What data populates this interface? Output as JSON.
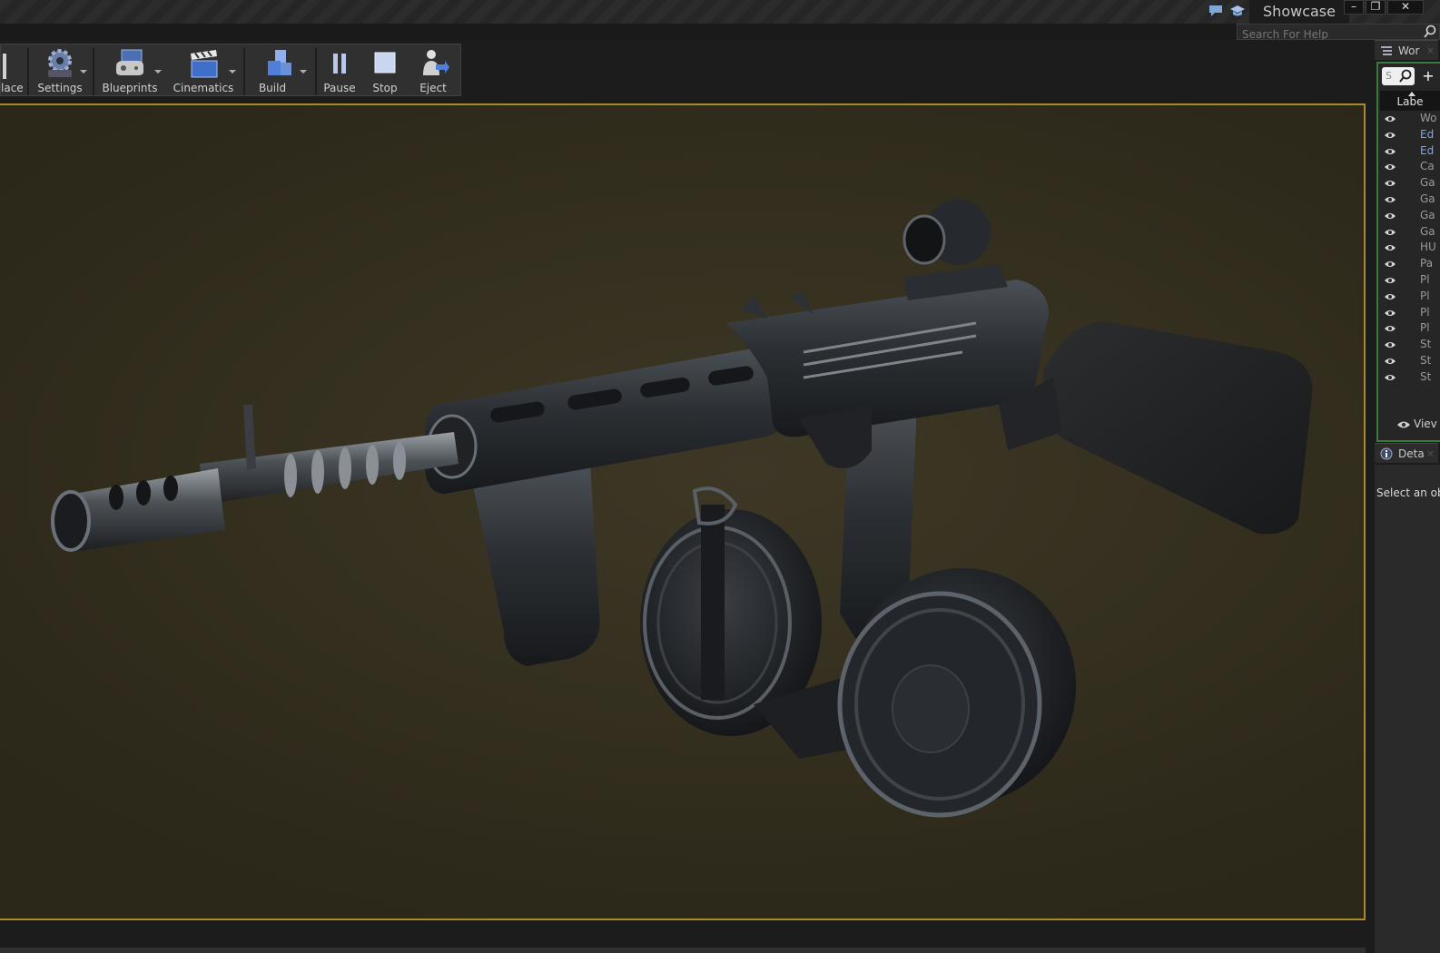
{
  "title_bar": {
    "project_name": "Showcase",
    "minimize": "–",
    "restore": "❐",
    "close": "✕"
  },
  "help_search": {
    "placeholder": "Search For Help"
  },
  "toolbar": {
    "buttons": [
      {
        "label": "lace"
      },
      {
        "label": "Settings"
      },
      {
        "label": "Blueprints"
      },
      {
        "label": "Cinematics"
      },
      {
        "label": "Build"
      },
      {
        "label": "Pause"
      },
      {
        "label": "Stop"
      },
      {
        "label": "Eject"
      }
    ]
  },
  "world_outliner": {
    "tab_label": "Wor",
    "search_placeholder": "S",
    "add_label": "+",
    "column_label": "Labe",
    "items": [
      {
        "name": "Wo",
        "color": "#9a9a9a"
      },
      {
        "name": "Ed",
        "color": "#6fa8ff"
      },
      {
        "name": "Ed",
        "color": "#6fa8ff"
      },
      {
        "name": "Ca",
        "color": "#9a9a9a"
      },
      {
        "name": "Ga",
        "color": "#9a9a9a"
      },
      {
        "name": "Ga",
        "color": "#9a9a9a"
      },
      {
        "name": "Ga",
        "color": "#9a9a9a"
      },
      {
        "name": "Ga",
        "color": "#9a9a9a"
      },
      {
        "name": "HU",
        "color": "#9a9a9a"
      },
      {
        "name": "Pa",
        "color": "#9a9a9a"
      },
      {
        "name": "Pl",
        "color": "#9a9a9a"
      },
      {
        "name": "Pl",
        "color": "#9a9a9a"
      },
      {
        "name": "Pl",
        "color": "#9a9a9a"
      },
      {
        "name": "Pl",
        "color": "#9a9a9a"
      },
      {
        "name": "St",
        "color": "#9a9a9a"
      },
      {
        "name": "St",
        "color": "#9a9a9a"
      },
      {
        "name": "St",
        "color": "#9a9a9a"
      }
    ],
    "view_options_label": "Viev"
  },
  "details": {
    "tab_label": "Deta",
    "empty_message": "Select an obj"
  },
  "colors": {
    "viewport_border": "#a88a2a",
    "outliner_border": "#3b7a3b"
  }
}
